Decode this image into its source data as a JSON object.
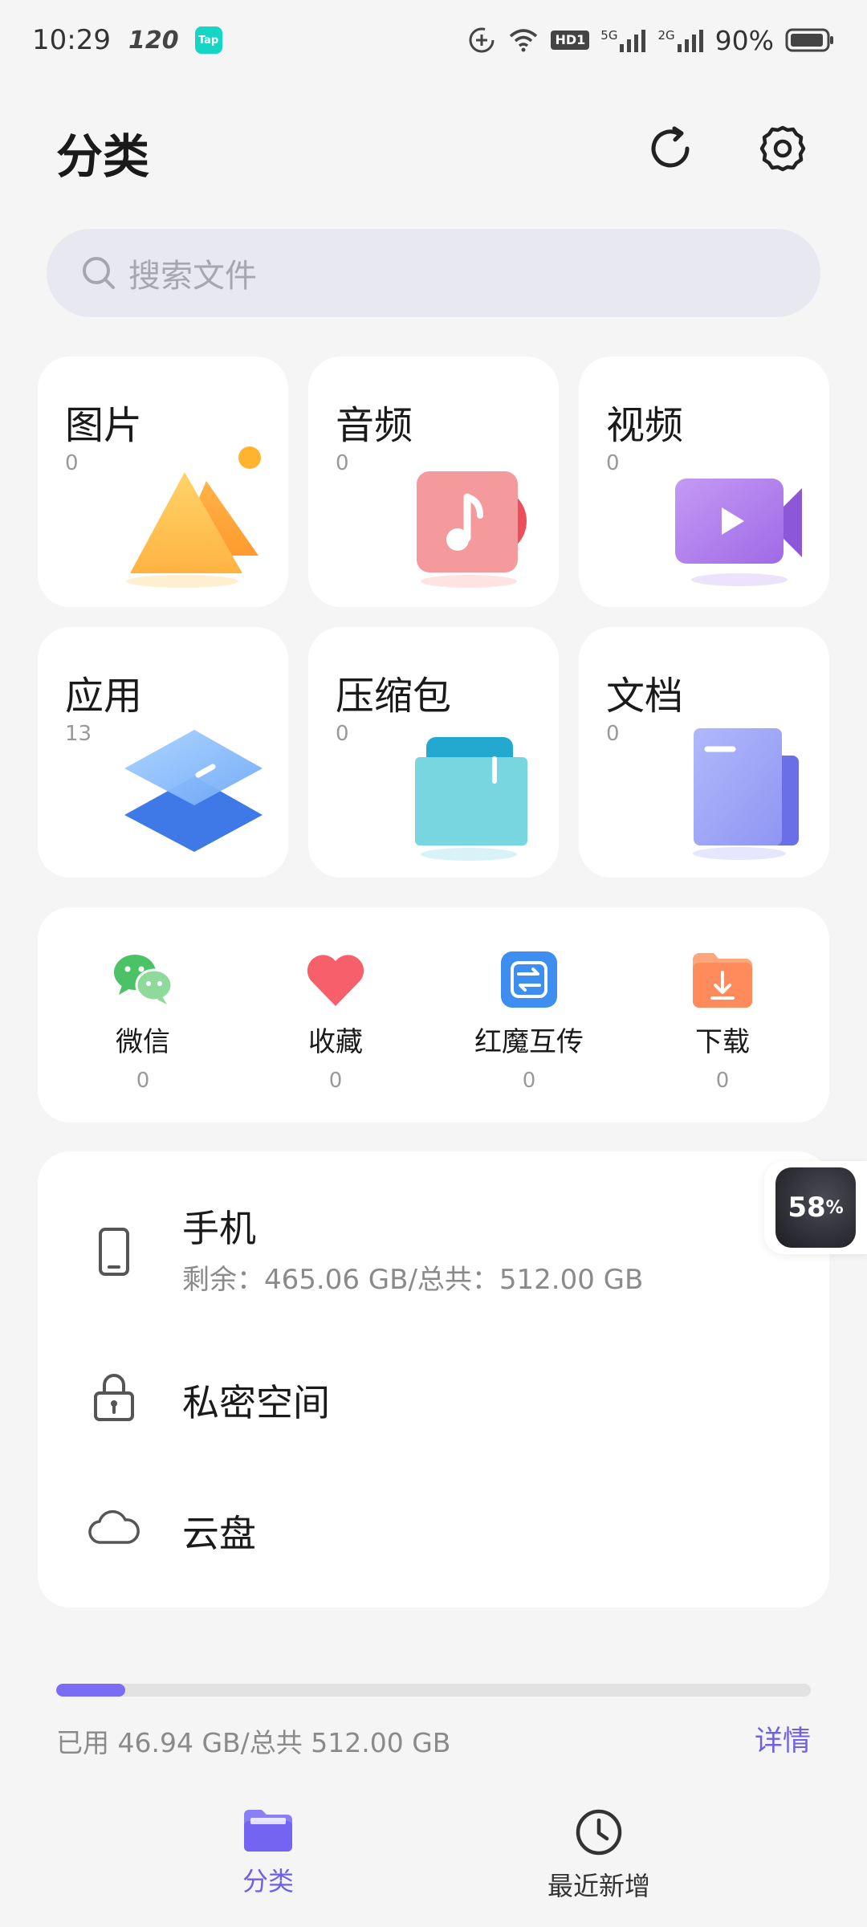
{
  "status_bar": {
    "time": "10:29",
    "refresh_rate": "120",
    "app_badge": "Tap",
    "network_5g": "5G",
    "network_2g": "2G",
    "hd_badge": "HD1",
    "battery_percent": "90%"
  },
  "header": {
    "title": "分类"
  },
  "search": {
    "placeholder": "搜索文件"
  },
  "categories": [
    {
      "label": "图片",
      "count": "0"
    },
    {
      "label": "音频",
      "count": "0"
    },
    {
      "label": "视频",
      "count": "0"
    },
    {
      "label": "应用",
      "count": "13"
    },
    {
      "label": "压缩包",
      "count": "0"
    },
    {
      "label": "文档",
      "count": "0"
    }
  ],
  "quick_access": [
    {
      "label": "微信",
      "count": "0",
      "icon": "wechat-icon"
    },
    {
      "label": "收藏",
      "count": "0",
      "icon": "heart-icon"
    },
    {
      "label": "红魔互传",
      "count": "0",
      "icon": "transfer-icon"
    },
    {
      "label": "下载",
      "count": "0",
      "icon": "download-icon"
    }
  ],
  "storage": {
    "phone": {
      "label": "手机",
      "detail": "剩余：465.06 GB/总共：512.00 GB"
    },
    "private": {
      "label": "私密空间"
    },
    "cloud": {
      "label": "云盘"
    }
  },
  "floating_badge": {
    "value": "58",
    "unit": "%"
  },
  "usage": {
    "text": "已用 46.94 GB/总共 512.00 GB",
    "used_fraction": 0.0917,
    "detail_link": "详情"
  },
  "bottom_nav": [
    {
      "label": "分类",
      "active": true
    },
    {
      "label": "最近新增",
      "active": false
    }
  ],
  "colors": {
    "accent": "#6f60e8",
    "background": "#f5f5f5",
    "card": "#ffffff"
  }
}
